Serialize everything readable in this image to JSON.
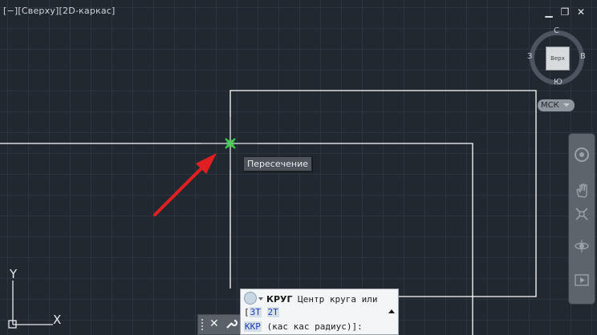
{
  "viewport": {
    "controls_label": "[−][Сверху][2D-каркас]"
  },
  "window_buttons": {
    "minimize": "▁",
    "restore": "❐",
    "close": "✕"
  },
  "snap_tooltip": "Пересечение",
  "viewcube": {
    "face_label": "Верх",
    "north": "С",
    "south": "Ю",
    "west": "З",
    "east": "В"
  },
  "ucs_menu": {
    "label": "МСК"
  },
  "navbar": {
    "items": [
      "steering-wheel-icon",
      "pan-hand-icon",
      "zoom-extents-icon",
      "orbit-icon",
      "showmotion-icon"
    ]
  },
  "ucs_axes": {
    "x": "X",
    "y": "Y"
  },
  "command_line": {
    "command": "КРУГ",
    "prompt_line1": "Центр круга или",
    "option_3t": "3Т",
    "option_2t": "2Т",
    "option_kkr": "ККР",
    "option_detail": "(кас кас радиус)",
    "prompt_end": "]:",
    "bracket_open": "["
  },
  "colors": {
    "background": "#212830",
    "grid": "#2c343e",
    "geometry": "#ffffff",
    "snap_marker": "#3ed44a",
    "arrow": "#e02020"
  }
}
